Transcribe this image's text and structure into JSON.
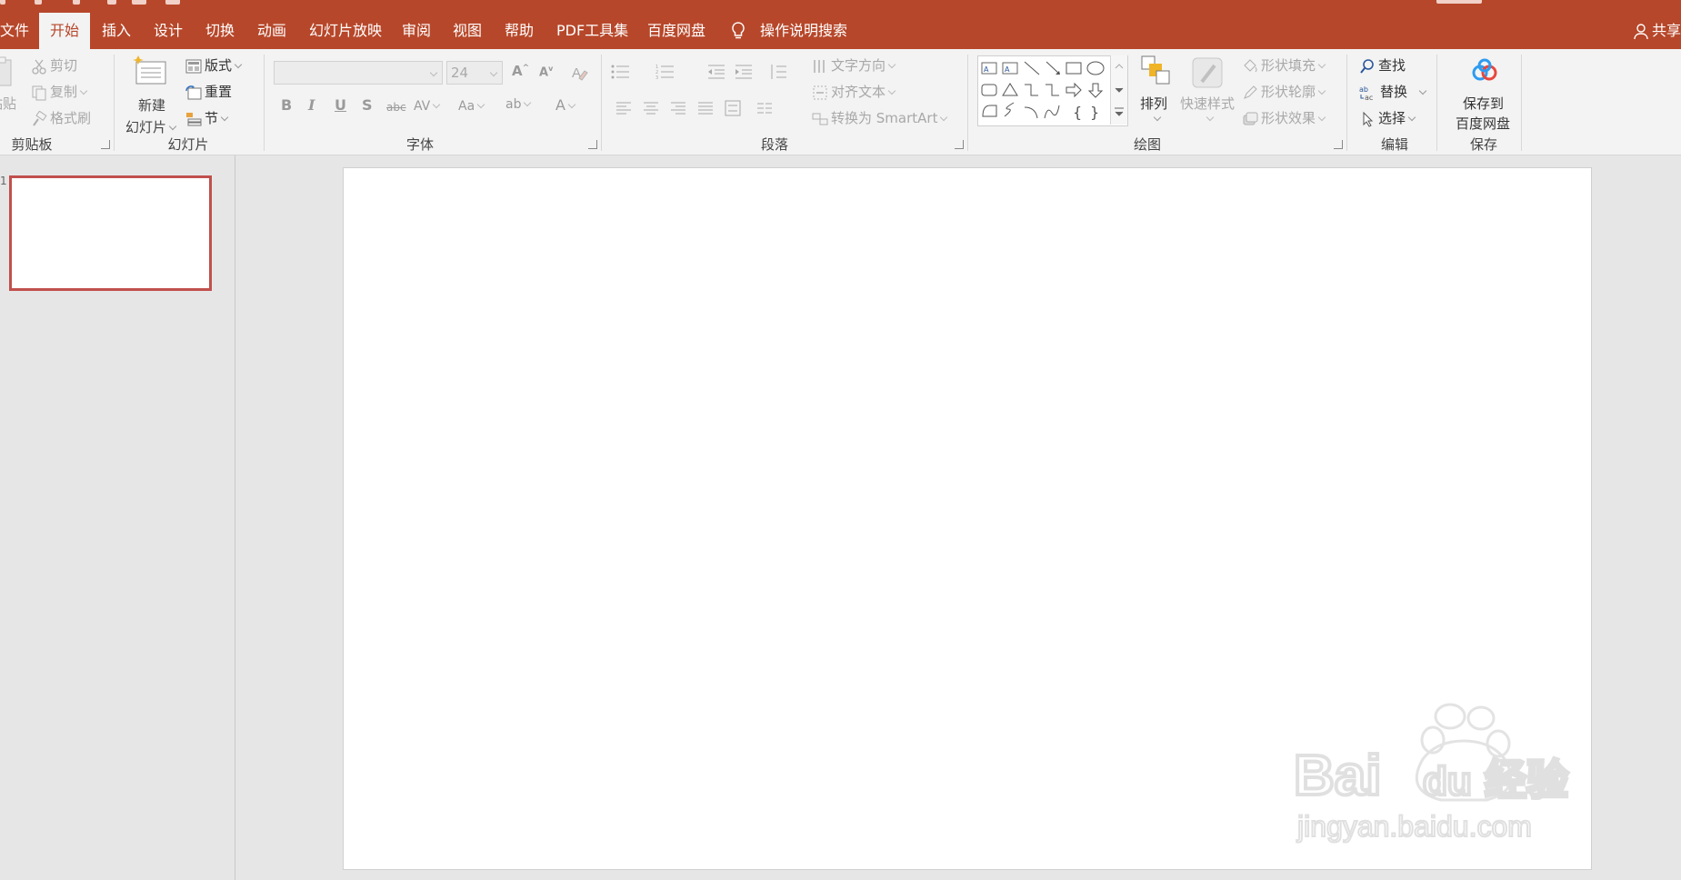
{
  "tabs": [
    {
      "label": "文件"
    },
    {
      "label": "开始",
      "active": true
    },
    {
      "label": "插入"
    },
    {
      "label": "设计"
    },
    {
      "label": "切换"
    },
    {
      "label": "动画"
    },
    {
      "label": "幻灯片放映"
    },
    {
      "label": "审阅"
    },
    {
      "label": "视图"
    },
    {
      "label": "帮助"
    },
    {
      "label": "PDF工具集"
    },
    {
      "label": "百度网盘"
    }
  ],
  "tell_me": "操作说明搜索",
  "share": "共享",
  "ribbon": {
    "clipboard": {
      "paste": "粘贴",
      "cut": "剪切",
      "copy": "复制",
      "format_painter": "格式刷",
      "group_label": "剪贴板"
    },
    "slides": {
      "new_slide_line1": "新建",
      "new_slide_line2": "幻灯片",
      "layout": "版式",
      "reset": "重置",
      "section": "节",
      "group_label": "幻灯片"
    },
    "font": {
      "font_name": "",
      "font_size": "24",
      "group_label": "字体"
    },
    "paragraph": {
      "text_direction": "文字方向",
      "align_text": "对齐文本",
      "convert_smartart": "转换为 SmartArt",
      "group_label": "段落"
    },
    "drawing": {
      "arrange": "排列",
      "quick_styles": "快速样式",
      "shape_fill": "形状填充",
      "shape_outline": "形状轮廓",
      "shape_effects": "形状效果",
      "group_label": "绘图"
    },
    "editing": {
      "find": "查找",
      "replace": "替换",
      "select": "选择",
      "group_label": "编辑"
    },
    "save": {
      "save_line1": "保存到",
      "save_line2": "百度网盘",
      "group_label": "保存"
    }
  },
  "slides_pane": {
    "thumbnail_number": "1"
  },
  "colors": {
    "accent": "#b7472a",
    "ribbon_bg": "#f3f3f3",
    "workspace_bg": "#e6e6e6",
    "thumbnail_border": "#c0504d"
  }
}
